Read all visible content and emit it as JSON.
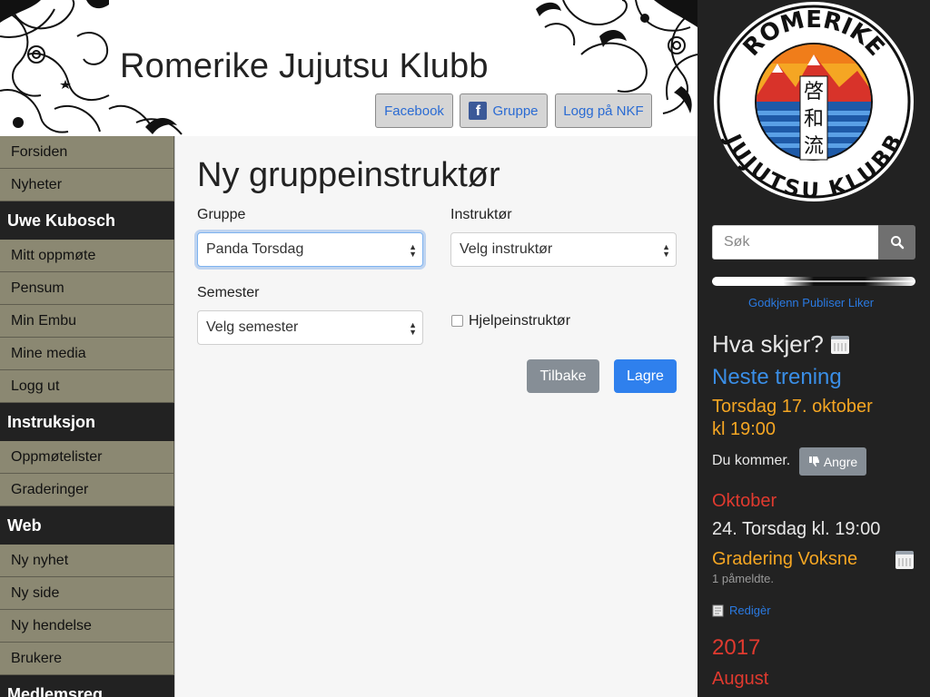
{
  "header": {
    "site_title": "Romerike Jujutsu Klubb",
    "buttons": {
      "facebook": "Facebook",
      "group": "Gruppe",
      "group_icon_letter": "f",
      "nkf": "Logg på NKF"
    }
  },
  "sidebar": {
    "items_top": [
      "Forsiden",
      "Nyheter"
    ],
    "user_heading": "Uwe Kubosch",
    "user_items": [
      "Mitt oppmøte",
      "Pensum",
      "Min Embu",
      "Mine media",
      "Logg ut"
    ],
    "instruction_heading": "Instruksjon",
    "instruction_items": [
      "Oppmøtelister",
      "Graderinger"
    ],
    "web_heading": "Web",
    "web_items": [
      "Ny nyhet",
      "Ny side",
      "Ny hendelse",
      "Brukere"
    ],
    "member_heading": "Medlemsreg"
  },
  "form": {
    "title": "Ny gruppeinstruktør",
    "group_label": "Gruppe",
    "group_value": "Panda Torsdag",
    "instructor_label": "Instruktør",
    "instructor_value": "Velg instruktør",
    "semester_label": "Semester",
    "semester_value": "Velg semester",
    "assistant_label": "Hjelpeinstruktør",
    "assistant_checked": false,
    "back_button": "Tilbake",
    "save_button": "Lagre"
  },
  "logo": {
    "top_text": "ROMERIKE",
    "bottom_text": "JUJUTSU KLUBB",
    "kanji": [
      "啓",
      "和",
      "流"
    ]
  },
  "right": {
    "search_placeholder": "Søk",
    "links": [
      "Godkjenn",
      "Publiser",
      "Liker"
    ],
    "what_heading": "Hva skjer?",
    "next_training_heading": "Neste trening",
    "next_training_date": "Torsdag 17. oktober",
    "next_training_time": "kl 19:00",
    "attending_text": "Du kommer.",
    "cancel_button": "Angre",
    "month": "Oktober",
    "event_date": "24. Torsdag kl. 19:00",
    "event_title": "Gradering Voksne",
    "event_signups": "1 påmeldte.",
    "edit_link": "Redigèr",
    "year": "2017",
    "month2": "August"
  },
  "colors": {
    "sidebar_item_bg": "#8b8872",
    "dark_bg": "#222222",
    "primary_blue": "#2f80ed",
    "secondary_gray": "#868e96",
    "link_blue": "#2a7ae2",
    "heading_blue": "#3a8ee6",
    "highlight_orange": "#f5a623",
    "month_red": "#e03a2f"
  }
}
